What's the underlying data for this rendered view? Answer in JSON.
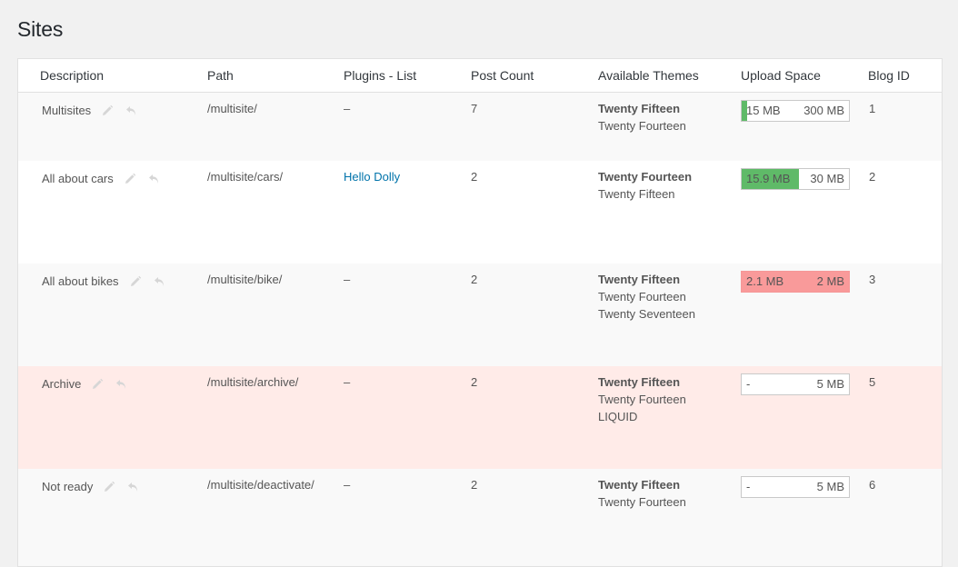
{
  "page": {
    "title": "Sites"
  },
  "columns": {
    "description": "Description",
    "path": "Path",
    "plugins": "Plugins - List",
    "post_count": "Post Count",
    "themes": "Available Themes",
    "upload_space": "Upload Space",
    "blog_id": "Blog ID"
  },
  "colors": {
    "upload_ok": "#5fba68",
    "upload_full": "#f99a9a",
    "archived_row": "#ffebe8",
    "link": "#0073aa"
  },
  "icons": {
    "edit": "pencil-icon",
    "revert": "undo-icon"
  },
  "rows": [
    {
      "description": "Multisites",
      "path": "/multisite/",
      "plugins": "–",
      "post_count": "7",
      "themes": [
        "Twenty Fifteen",
        "Twenty Fourteen"
      ],
      "upload_used": "15 MB",
      "upload_max": "300 MB",
      "upload_fraction": 0.05,
      "blog_id": "1"
    },
    {
      "description": "All about cars",
      "path": "/multisite/cars/",
      "plugins": "Hello Dolly",
      "post_count": "2",
      "themes": [
        "Twenty Fourteen",
        "Twenty Fifteen"
      ],
      "upload_used": "15.9 MB",
      "upload_max": "30 MB",
      "upload_fraction": 0.53,
      "blog_id": "2"
    },
    {
      "description": "All about bikes",
      "path": "/multisite/bike/",
      "plugins": "–",
      "post_count": "2",
      "themes": [
        "Twenty Fifteen",
        "Twenty Fourteen",
        "Twenty Seventeen"
      ],
      "upload_used": "2.1 MB",
      "upload_max": "2 MB",
      "upload_fraction": 1.0,
      "blog_id": "3"
    },
    {
      "description": "Archive",
      "path": "/multisite/archive/",
      "plugins": "–",
      "post_count": "2",
      "themes": [
        "Twenty Fifteen",
        "Twenty Fourteen",
        "LIQUID"
      ],
      "upload_used": "-",
      "upload_max": "5 MB",
      "upload_fraction": 0,
      "blog_id": "5"
    },
    {
      "description": "Not ready",
      "path": "/multisite/deactivate/",
      "plugins": "–",
      "post_count": "2",
      "themes": [
        "Twenty Fifteen",
        "Twenty Fourteen"
      ],
      "upload_used": "-",
      "upload_max": "5 MB",
      "upload_fraction": 0,
      "blog_id": "6"
    }
  ]
}
